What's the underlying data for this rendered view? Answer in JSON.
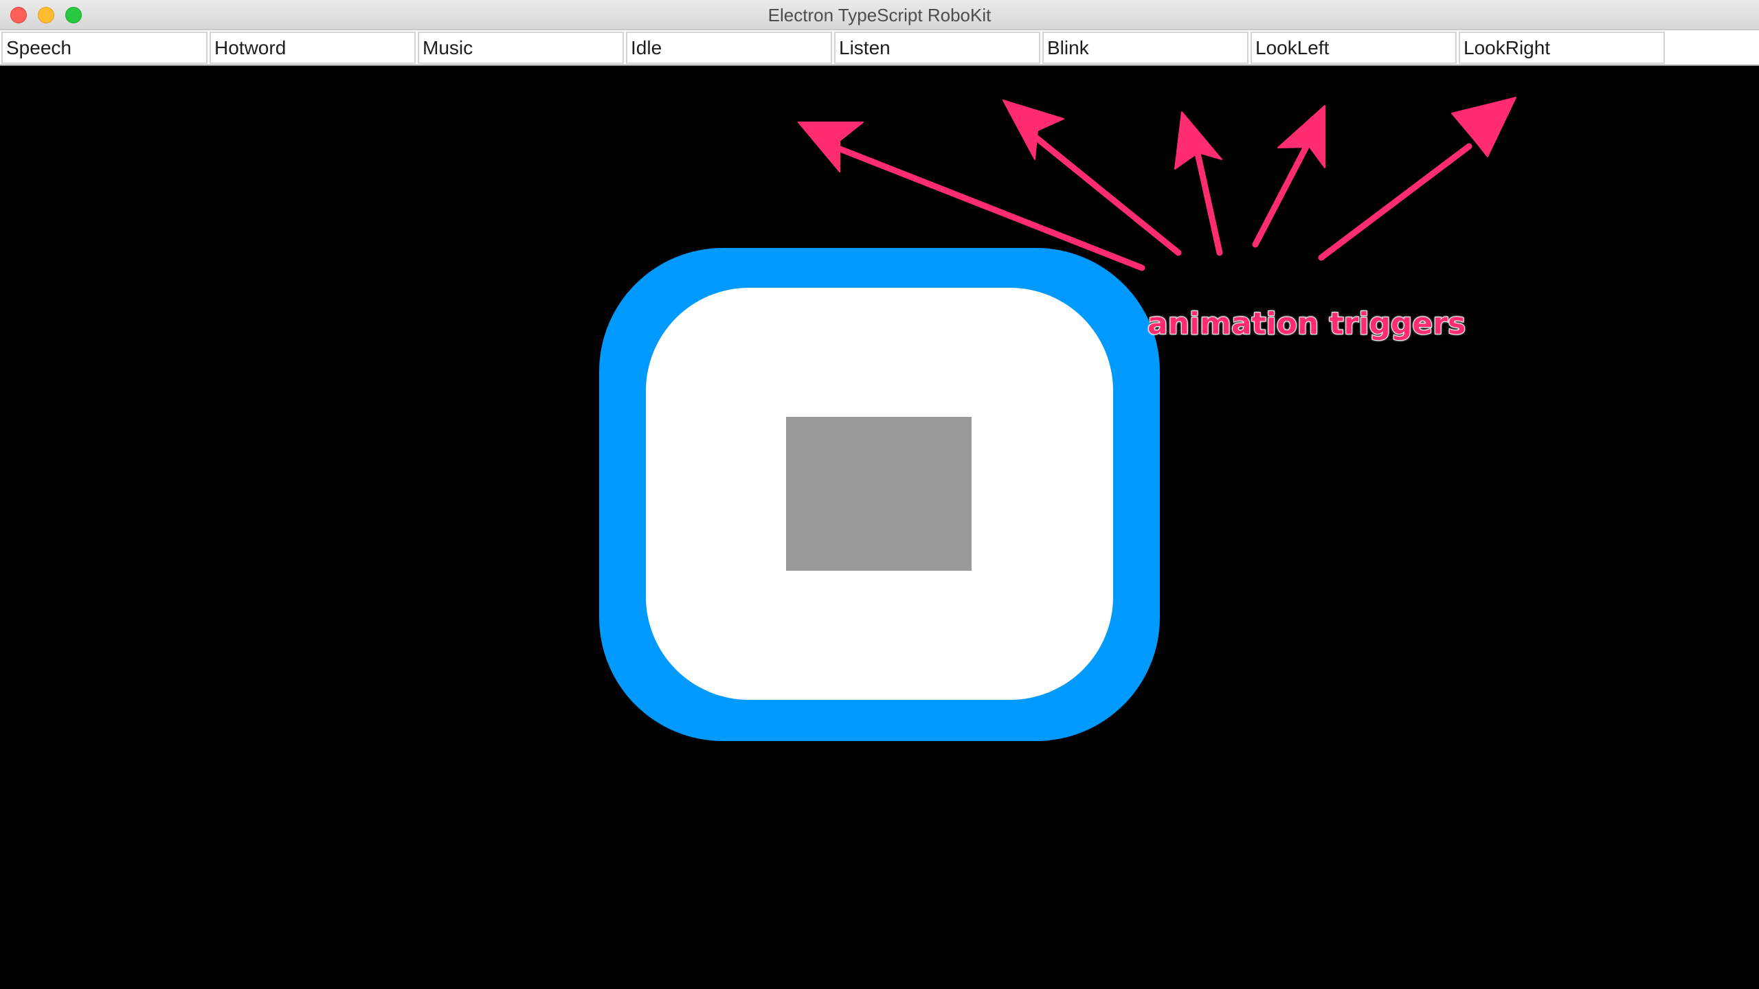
{
  "window": {
    "title": "Electron TypeScript RoboKit"
  },
  "toolbar": {
    "buttons": [
      {
        "label": "Speech"
      },
      {
        "label": "Hotword"
      },
      {
        "label": "Music"
      },
      {
        "label": "Idle"
      },
      {
        "label": "Listen"
      },
      {
        "label": "Blink"
      },
      {
        "label": "LookLeft"
      },
      {
        "label": "LookRight"
      }
    ]
  },
  "annotation": {
    "label": "animation triggers",
    "color": "#ff2d6f"
  },
  "robot": {
    "face_color": "#0099fe",
    "inner_color": "#ffffff",
    "eye_color": "#999999"
  }
}
